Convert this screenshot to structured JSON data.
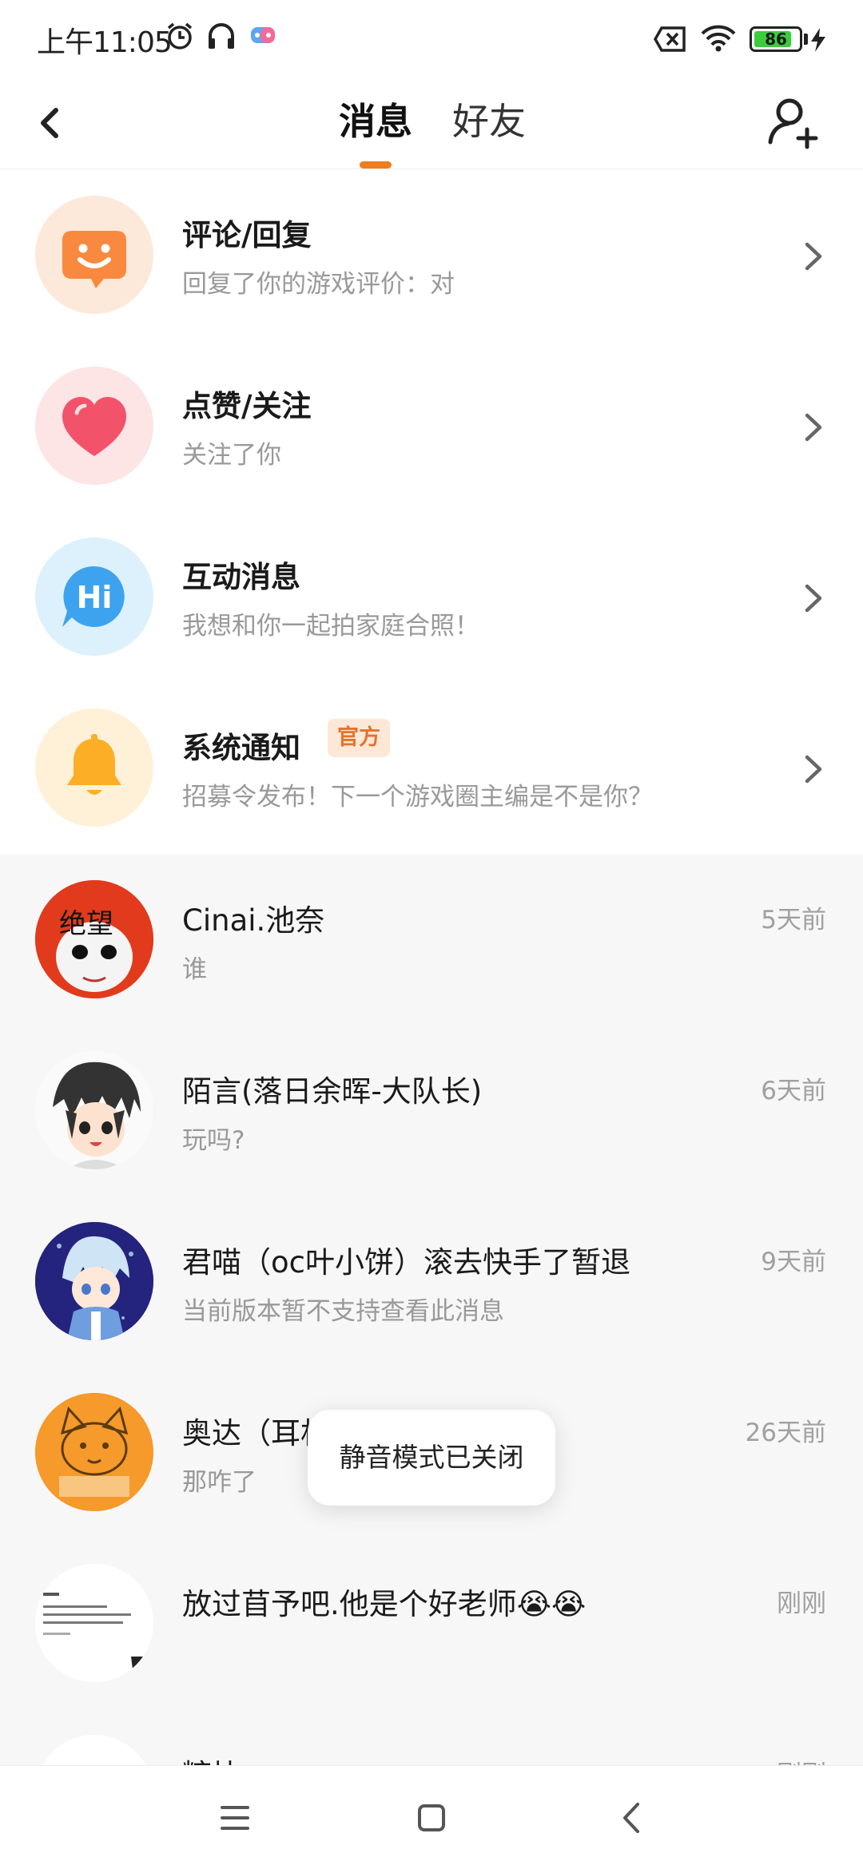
{
  "status_bar": {
    "time": "上午11:05",
    "battery": "86",
    "battery_level": 0.86
  },
  "header": {
    "tabs": [
      {
        "label": "消息"
      },
      {
        "label": "好友"
      }
    ]
  },
  "categories": [
    {
      "title": "评论/回复",
      "subtitle": "回复了你的游戏评价：对",
      "icon": "smile-chat-icon"
    },
    {
      "title": "点赞/关注",
      "subtitle": "关注了你",
      "icon": "heart-icon"
    },
    {
      "title": "互动消息",
      "subtitle": "我想和你一起拍家庭合照！",
      "icon": "hi-bubble-icon"
    },
    {
      "title": "系统通知",
      "subtitle": "招募令发布！下一个游戏圈主编是不是你？",
      "badge": "官方",
      "icon": "bell-icon"
    }
  ],
  "messages": [
    {
      "name": "Cinai.池奈",
      "text": "谁",
      "time": "5天前",
      "avatar_text": "绝望"
    },
    {
      "name": "陌言(落日余晖-大队长)",
      "text": "玩吗?",
      "time": "6天前"
    },
    {
      "name": "君喵（oc叶小饼）滚去快手了暂退",
      "text": "当前版本暂不支持查看此消息",
      "time": "9天前"
    },
    {
      "name": "奥达（耳机喵）(君喵)(暂退)",
      "text": "那咋了",
      "time": "26天前"
    },
    {
      "name": "放过苜予吧.他是个好老师😭😭",
      "text": "",
      "time": "刚刚"
    },
    {
      "name": "糖块",
      "text": "",
      "time": "刚刚"
    }
  ],
  "toast": {
    "text": "静音模式已关闭"
  },
  "colors": {
    "accent": "#f07c1e",
    "badge_bg": "#fde8d8",
    "badge_text": "#e2732c"
  }
}
